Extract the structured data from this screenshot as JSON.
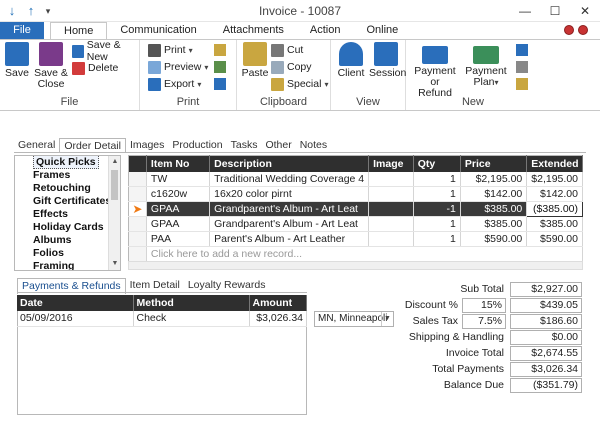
{
  "window": {
    "title": "Invoice - 10087"
  },
  "ribbon_tabs": [
    "File",
    "Home",
    "Communication",
    "Attachments",
    "Action",
    "Online"
  ],
  "ribbon": {
    "file_group": {
      "label": "File",
      "save": "Save",
      "save_close": "Save & Close",
      "save_new": "Save & New",
      "delete": "Delete"
    },
    "print_group": {
      "label": "Print",
      "print": "Print",
      "preview": "Preview",
      "export": "Export"
    },
    "clipboard_group": {
      "label": "Clipboard",
      "paste": "Paste",
      "cut": "Cut",
      "copy": "Copy",
      "special": "Special"
    },
    "view_group": {
      "label": "View",
      "client": "Client",
      "session": "Session"
    },
    "new_group": {
      "label": "New",
      "payment_refund": "Payment or Refund",
      "payment_plan": "Payment Plan"
    }
  },
  "detail_tabs": [
    "General",
    "Order Detail",
    "Images",
    "Production",
    "Tasks",
    "Other",
    "Notes"
  ],
  "categories": [
    "Quick Picks",
    "Frames",
    "Retouching",
    "Gift Certificates",
    "Effects",
    "Holiday Cards",
    "Albums",
    "Folios",
    "Framing"
  ],
  "items_table": {
    "columns": [
      "Item No",
      "Description",
      "Image",
      "Qty",
      "Price",
      "Extended"
    ],
    "rows": [
      {
        "item": "TW",
        "desc": "Traditional Wedding Coverage 4",
        "image": "",
        "qty": "1",
        "price": "$2,195.00",
        "ext": "$2,195.00"
      },
      {
        "item": "c1620w",
        "desc": "16x20 color pirnt",
        "image": "",
        "qty": "1",
        "price": "$142.00",
        "ext": "$142.00"
      },
      {
        "item": "GPAA",
        "desc": "Grandparent's Album - Art Leat",
        "image": "",
        "qty": "-1",
        "price": "$385.00",
        "ext": "($385.00)"
      },
      {
        "item": "GPAA",
        "desc": "Grandparent's Album - Art Leat",
        "image": "",
        "qty": "1",
        "price": "$385.00",
        "ext": "$385.00"
      },
      {
        "item": "PAA",
        "desc": "Parent's Album - Art Leather",
        "image": "",
        "qty": "1",
        "price": "$590.00",
        "ext": "$590.00"
      }
    ],
    "new_row_placeholder": "Click here to add a new record..."
  },
  "payment_tabs": [
    "Payments & Refunds",
    "Item Detail",
    "Loyalty Rewards"
  ],
  "payments_table": {
    "columns": [
      "Date",
      "Method",
      "Amount"
    ],
    "rows": [
      {
        "date": "05/09/2016",
        "method": "Check",
        "amount": "$3,026.34"
      }
    ]
  },
  "location": "MN, Minneapoli",
  "totals": {
    "sub_total_label": "Sub Total",
    "sub_total": "$2,927.00",
    "discount_label": "Discount %",
    "discount_pct": "15%",
    "discount": "$439.05",
    "sales_tax_label": "Sales Tax",
    "sales_tax_pct": "7.5%",
    "sales_tax": "$186.60",
    "shipping_label": "Shipping & Handling",
    "shipping": "$0.00",
    "invoice_total_label": "Invoice Total",
    "invoice_total": "$2,674.55",
    "total_payments_label": "Total Payments",
    "total_payments": "$3,026.34",
    "balance_due_label": "Balance Due",
    "balance_due": "($351.79)"
  },
  "colors": {
    "accent": "#2a6ebb",
    "header_dark": "#2f2f2f",
    "arrow": "#f07a14"
  }
}
